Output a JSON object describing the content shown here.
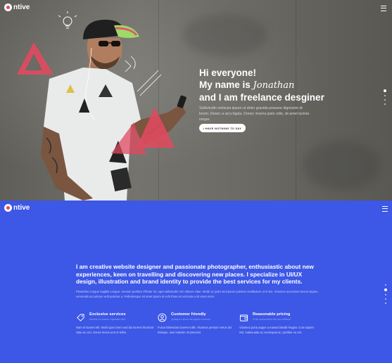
{
  "hero": {
    "logo_text": "ntive",
    "headline": {
      "line1": "Hi everyone!",
      "line2_prefix": "My name is ",
      "name": "Jonathan",
      "line3": "and I am freelance desginer"
    },
    "subtext": "Sollicitudin vehicula ipsum ut dolor gravida posuere dignissim id lorem. Donec a arcu ligula. Donec viverra justo odio, sit amet lacinia neque.",
    "cta_label": "I HAVE NOTHING TO SAY"
  },
  "about": {
    "logo_text": "ntive",
    "lead": "I am creative website designer and passionate photographer, enthusiastic about new experiences, keen on travelling and discovering new places. I specialize in UI/UX design, illustration and brand identity to provide the best services for my clients.",
    "body": "Phasellus congue sagittis congue. Aenean porttitor efficitur mi, eget sollicitudin orci ultrices vitae. Morbi ac justo sed ipsum pulvinar vestibulum ut et leo. Vivamus accumsan lectus sapien, venenatis accumsan velit pulvinar a. Pellentesque sit amet ipsum id velit rhoncus vehicula a sit amet enim.",
    "features": [
      {
        "icon": "tag-icon",
        "title": "Exclusive services",
        "subtitle": "Aenean id mauris vulputate nibh",
        "desc": "Nam et laoreet elit. Morbi quis lorem sed dui laoreet tincidunt vitae ac orci. Donec luctus erat et tellus."
      },
      {
        "icon": "user-circle-icon",
        "title": "Customer friendly",
        "subtitle": "Quisque rutrum est sapien rhoncus",
        "desc": "Fusce bibendum laoreet nulla. Vivamus pretium metus dui tristique, sed molestie mi placerat."
      },
      {
        "icon": "wallet-icon",
        "title": "Reasonable pricing",
        "subtitle": "Proin consectetur dui orci eleifend",
        "desc": "Vivamus porta augue a massa blandit feugiat. Cras sapien nisl, malesuada ac consequat ac, porttitor eu est."
      }
    ]
  },
  "colors": {
    "accent_blue": "#3d57e6",
    "triangle_red": "#e04a5f"
  }
}
